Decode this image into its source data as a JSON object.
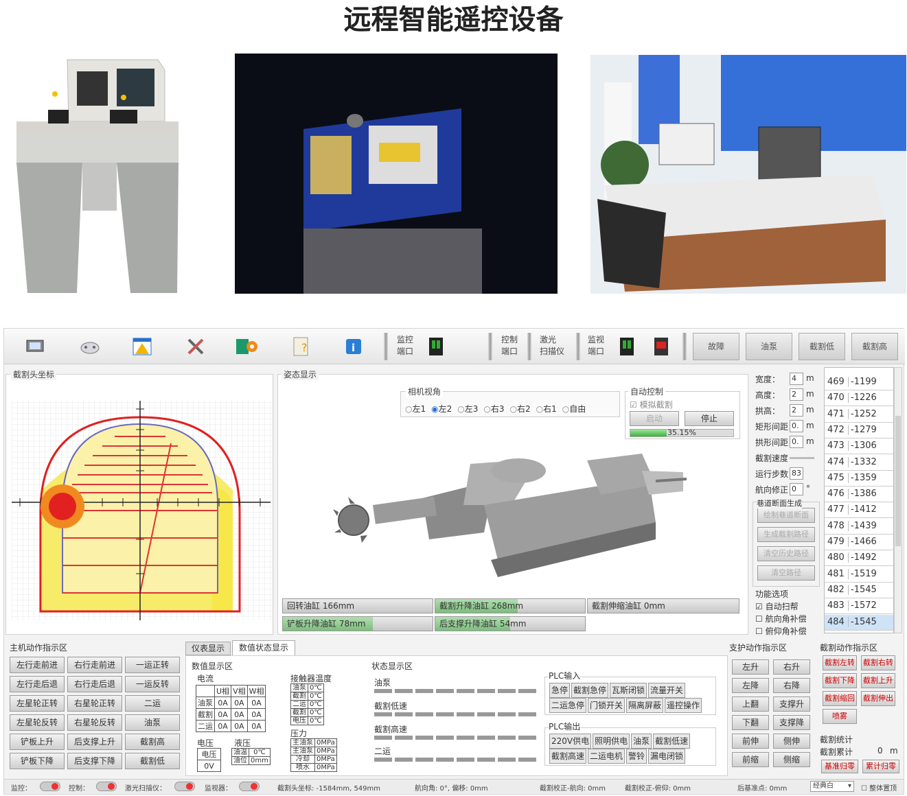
{
  "page_title": "远程智能遥控设备",
  "toolbar": {
    "labels": [
      {
        "l1": "监控",
        "l2": "端口"
      },
      {
        "l1": "控制",
        "l2": "端口"
      },
      {
        "l1": "激光",
        "l2": "扫描仪"
      },
      {
        "l1": "监视",
        "l2": "端口"
      }
    ],
    "buttons": [
      "故障",
      "油泵",
      "截割低",
      "截割高"
    ]
  },
  "coord_panel": {
    "title": "截割头坐标"
  },
  "attitude_panel": {
    "title": "姿态显示",
    "camera_title": "相机视角",
    "cameras": [
      "左1",
      "左2",
      "左3",
      "右3",
      "右2",
      "右1",
      "自由"
    ],
    "selected_camera": "左2",
    "auto_title": "自动控制",
    "sim_cut": "模拟截割",
    "start": "启动",
    "stop": "停止",
    "progress_text": "35.15%",
    "progress": 0.3515,
    "cylinders": [
      {
        "label": "回转油缸",
        "value": "166mm",
        "fill": 0.0
      },
      {
        "label": "截割升降油缸",
        "value": "268mm",
        "fill": 0.55
      },
      {
        "label": "截割伸缩油缸",
        "value": "0mm",
        "fill": 0.0
      },
      {
        "label": "铲板升降油缸",
        "value": "78mm",
        "fill": 0.6
      },
      {
        "label": "后支撑升降油缸",
        "value": "54mm",
        "fill": 0.5
      }
    ]
  },
  "params": {
    "rows": [
      {
        "label": "宽度：",
        "value": "4",
        "unit": "m"
      },
      {
        "label": "高度：",
        "value": "2",
        "unit": "m"
      },
      {
        "label": "拱高：",
        "value": "2",
        "unit": "m"
      },
      {
        "label": "矩形间距",
        "value": "0.",
        "unit": "m"
      },
      {
        "label": "拱形间距",
        "value": "0.",
        "unit": "m"
      },
      {
        "label": "截割速度",
        "value": "",
        "unit": ""
      },
      {
        "label": "运行步数",
        "value": "83",
        "unit": ""
      },
      {
        "label": "航向修正",
        "value": "0",
        "unit": "°"
      }
    ],
    "section_title": "巷道断面生成",
    "section_btns": [
      "绘制巷道断面",
      "生成截割路径",
      "清空历史路径",
      "清空路径"
    ],
    "func_title": "功能选项",
    "func_opts": [
      {
        "label": "自动扫帮",
        "checked": true
      },
      {
        "label": "航向角补偿",
        "checked": false
      },
      {
        "label": "俯仰角补偿",
        "checked": false
      }
    ]
  },
  "index_list": [
    {
      "i": "469",
      "v": "-1199"
    },
    {
      "i": "470",
      "v": "-1226"
    },
    {
      "i": "471",
      "v": "-1252"
    },
    {
      "i": "472",
      "v": "-1279"
    },
    {
      "i": "473",
      "v": "-1306"
    },
    {
      "i": "474",
      "v": "-1332"
    },
    {
      "i": "475",
      "v": "-1359"
    },
    {
      "i": "476",
      "v": "-1386"
    },
    {
      "i": "477",
      "v": "-1412"
    },
    {
      "i": "478",
      "v": "-1439"
    },
    {
      "i": "479",
      "v": "-1466"
    },
    {
      "i": "480",
      "v": "-1492"
    },
    {
      "i": "481",
      "v": "-1519"
    },
    {
      "i": "482",
      "v": "-1545"
    },
    {
      "i": "483",
      "v": "-1572"
    },
    {
      "i": "484",
      "v": "-1545"
    }
  ],
  "main_actions": {
    "title": "主机动作指示区",
    "buttons": [
      [
        "左行走前进",
        "右行走前进",
        "一运正转"
      ],
      [
        "左行走后退",
        "右行走后退",
        "一运反转"
      ],
      [
        "左星轮正转",
        "右星轮正转",
        "二运"
      ],
      [
        "左星轮反转",
        "右星轮反转",
        "油泵"
      ],
      [
        "铲板上升",
        "后支撑上升",
        "截割高"
      ],
      [
        "铲板下降",
        "后支撑下降",
        "截割低"
      ]
    ]
  },
  "tabs": [
    "仪表显示",
    "数值状态显示"
  ],
  "numeric": {
    "title": "数值显示区",
    "current_title": "电流",
    "current_headers": [
      "",
      "U相",
      "V相",
      "W相"
    ],
    "current_rows": [
      [
        "油泵",
        "0A",
        "0A",
        "0A"
      ],
      [
        "截割",
        "0A",
        "0A",
        "0A"
      ],
      [
        "二运",
        "0A",
        "0A",
        "0A"
      ]
    ],
    "contactor_title": "接触器温度",
    "contactor_rows": [
      [
        "油泵",
        "0℃"
      ],
      [
        "截割",
        "0℃"
      ],
      [
        "二运",
        "0℃"
      ],
      [
        "截割",
        "0℃"
      ],
      [
        "电压",
        "0℃"
      ]
    ],
    "voltage_title": "电压",
    "voltage_label": "电压",
    "voltage_value": "0V",
    "hydraulic_title": "液压",
    "hydraulic_rows": [
      [
        "油温",
        "0℃"
      ],
      [
        "油位",
        "0mm"
      ]
    ],
    "pressure_title": "压力",
    "pressure_rows": [
      [
        "主油泵",
        "0MPa"
      ],
      [
        "主油泵",
        "0MPa"
      ],
      [
        "冷却",
        "0MPa"
      ],
      [
        "喷水",
        "0MPa"
      ]
    ]
  },
  "status": {
    "title": "状态显示区",
    "groups": [
      "油泵",
      "截割低速",
      "截割高速",
      "二运"
    ],
    "plc_in_title": "PLC输入",
    "plc_in": [
      [
        "急停",
        "截割急停",
        "瓦斯闭锁",
        "流量开关"
      ],
      [
        "二运急停",
        "门锁开关",
        "隔离屏蔽",
        "遥控操作"
      ]
    ],
    "plc_out_title": "PLC输出",
    "plc_out": [
      [
        "220V供电",
        "照明供电",
        "油泵",
        "截割低速"
      ],
      [
        "截割高速",
        "二运电机",
        "警铃",
        "漏电闭锁"
      ]
    ]
  },
  "support_actions": {
    "title": "支护动作指示区",
    "buttons": [
      [
        "左升",
        "右升"
      ],
      [
        "左降",
        "右降"
      ],
      [
        "上翻",
        "支撑升"
      ],
      [
        "下翻",
        "支撑降"
      ],
      [
        "前伸",
        "侧伸"
      ],
      [
        "前缩",
        "侧缩"
      ]
    ]
  },
  "cut_actions": {
    "title": "截割动作指示区",
    "buttons": [
      [
        "截割左转",
        "截割右转"
      ],
      [
        "截割下降",
        "截割上升"
      ],
      [
        "截割缩回",
        "截割伸出"
      ],
      [
        "喷雾",
        ""
      ]
    ]
  },
  "cut_stats": {
    "title": "截割统计",
    "total_label": "截割累计",
    "total_value": "0",
    "total_unit": "m",
    "calibrate": "基准归零",
    "reset": "累计归零"
  },
  "statusbar": {
    "items": [
      "监控：",
      "控制：",
      "激光扫描仪：",
      "监视器："
    ],
    "coords": "截割头坐标: -1584mm, 549mm",
    "heading": "航向角: 0°, 偏移: 0mm",
    "cut_head_fix": "截割校正-航向: 0mm",
    "cut_pitch_fix": "截割校正-俯仰: 0mm",
    "back_fix": "后基准点: 0mm",
    "mode": "经典白",
    "body_check": "整体置顶"
  },
  "colors": {
    "accent": "#e02020",
    "fill_yellow": "#f7e74a",
    "grid": "#cccccc"
  }
}
